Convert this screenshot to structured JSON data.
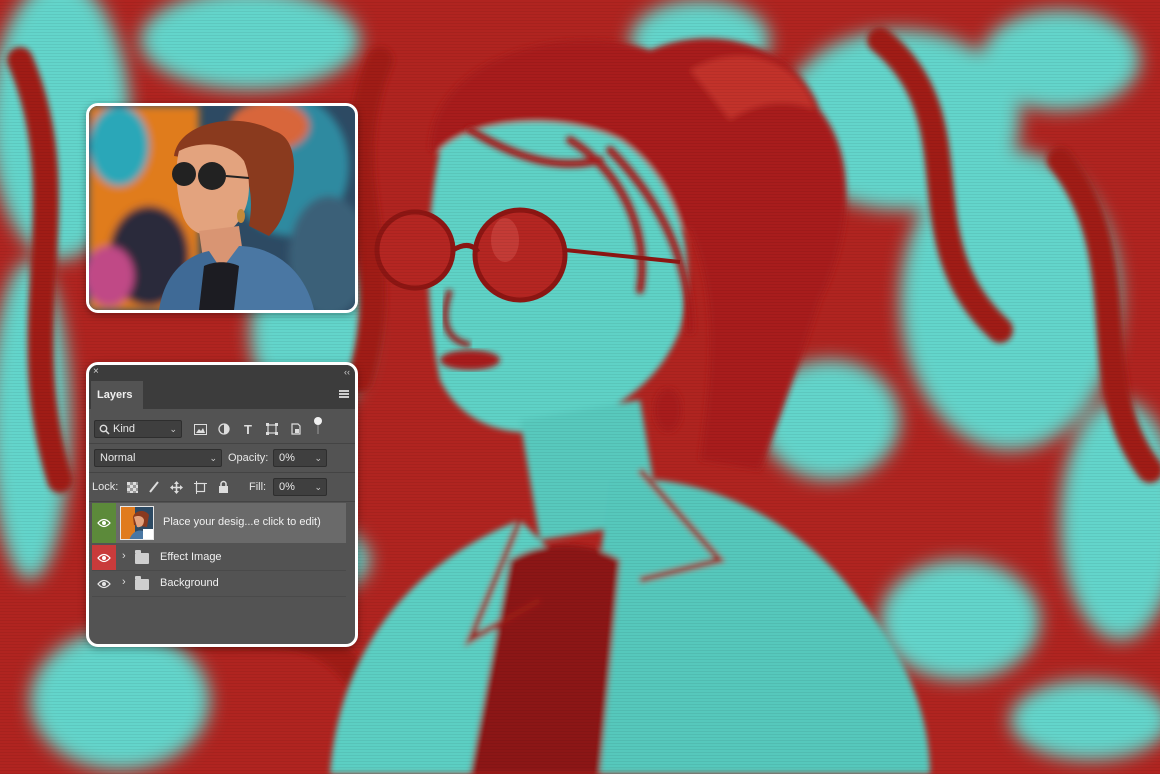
{
  "colors": {
    "duotone_red": "#b3221e",
    "duotone_cyan": "#5fd6cc",
    "panel_bg": "#535353",
    "eye_green": "#5c8a3a",
    "eye_red": "#c93b3b"
  },
  "panel": {
    "close_glyph": "×",
    "collapse_glyph": "‹‹",
    "tab_label": "Layers",
    "filter": {
      "value": "Kind",
      "icons": [
        "image-filter-icon",
        "adjustment-filter-icon",
        "type-filter-icon",
        "shape-filter-icon",
        "smart-object-filter-icon",
        "filter-toggle-icon"
      ]
    },
    "blend_mode": "Normal",
    "opacity_label": "Opacity:",
    "opacity_value": "0%",
    "lock_label": "Lock:",
    "fill_label": "Fill:",
    "fill_value": "0%",
    "layers": [
      {
        "name": "Place your desig...e click to edit)",
        "type": "smart-object",
        "visible": true,
        "selected": true
      },
      {
        "name": "Effect Image",
        "type": "group",
        "visible": true,
        "selected": false
      },
      {
        "name": "Background",
        "type": "group",
        "visible": true,
        "selected": false
      }
    ]
  }
}
